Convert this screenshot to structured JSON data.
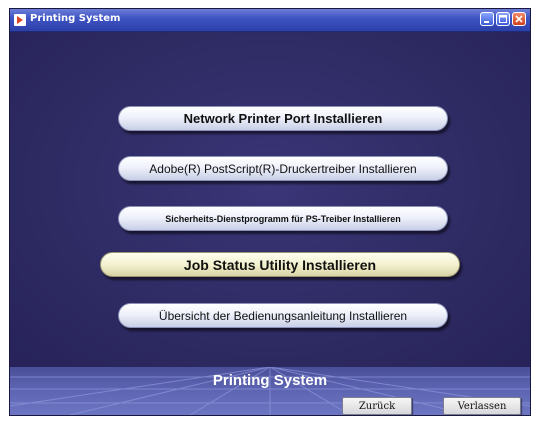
{
  "window": {
    "title": "Printing System"
  },
  "menu": {
    "items": [
      {
        "label": "Network Printer Port Installieren"
      },
      {
        "label": "Adobe(R) PostScript(R)-Druckertreiber Installieren"
      },
      {
        "label": "Sicherheits-Dienstprogramm für PS-Treiber Installieren"
      },
      {
        "label": "Job Status Utility Installieren"
      },
      {
        "label": "Übersicht der Bedienungsanleitung Installieren"
      }
    ],
    "highlighted_index": 3
  },
  "footer": {
    "title": "Printing System",
    "back_label": "Zurück",
    "exit_label": "Verlassen"
  },
  "colors": {
    "background": "#2e2a60",
    "titlebar": "#3f55c4",
    "button_face": "#eef1fb",
    "button_highlight": "#f3f1cf",
    "footer": "#5e66b4"
  }
}
